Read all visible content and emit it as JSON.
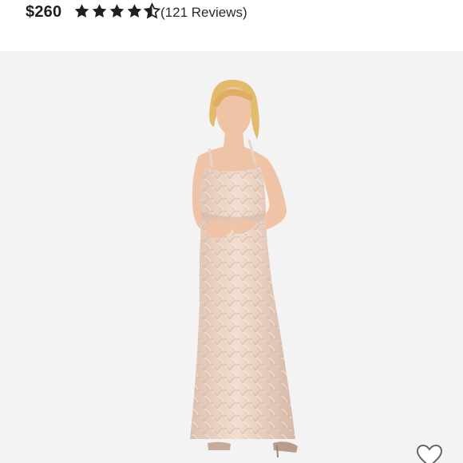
{
  "header": {
    "price": "$260",
    "rating_stars": 4.5,
    "reviews_text": "(121 Reviews)"
  },
  "product_image": {
    "description_icon": "dress-photo",
    "colors": {
      "background": "#f4f3f4",
      "dress": "#ead4c5",
      "skin": "#efc4a6",
      "hair": "#e2bb6f"
    }
  },
  "actions": {
    "favorite_icon": "heart-outline-icon"
  }
}
